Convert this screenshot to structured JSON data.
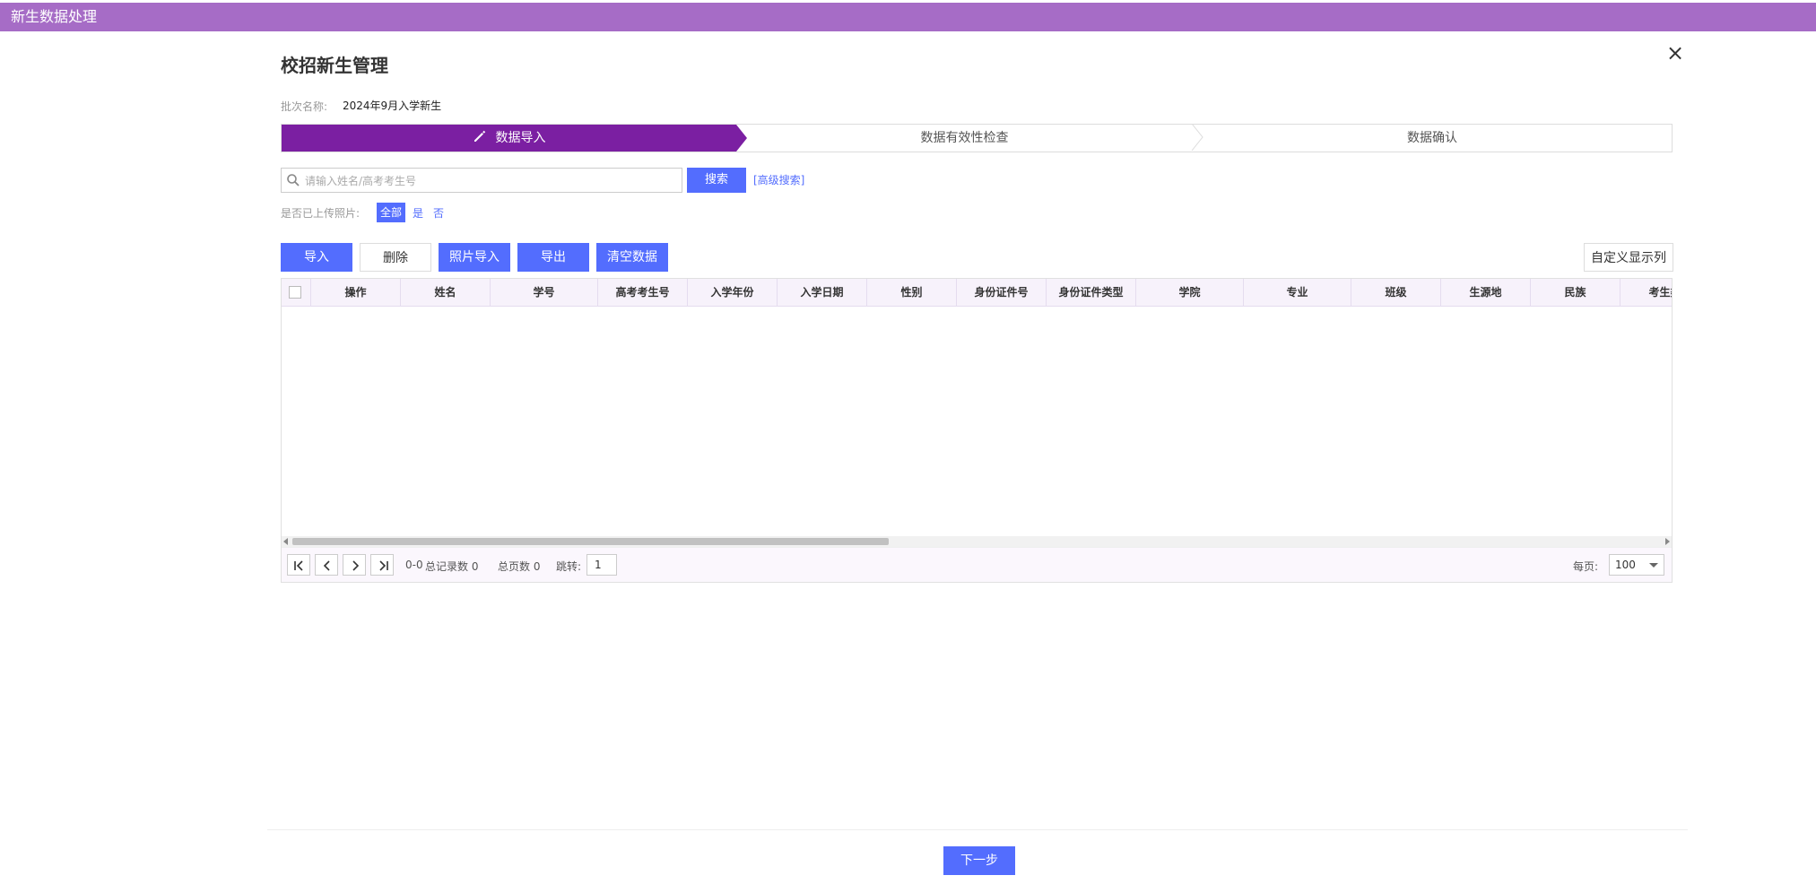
{
  "topbar": {
    "title": "新生数据处理"
  },
  "dialog": {
    "title": "校招新生管理",
    "close_symbol": "×",
    "batch_label": "批次名称:",
    "batch_value": "2024年9月入学新生"
  },
  "steps": [
    {
      "label": "数据导入",
      "active": true,
      "icon": "pencil-icon"
    },
    {
      "label": "数据有效性检查",
      "active": false
    },
    {
      "label": "数据确认",
      "active": false
    }
  ],
  "search": {
    "placeholder": "请输入姓名/高考考生号",
    "value": "",
    "button": "搜索",
    "advanced": "[高级搜索]"
  },
  "photo_filter": {
    "label": "是否已上传照片:",
    "options": [
      "全部",
      "是",
      "否"
    ],
    "selected": "全部"
  },
  "toolbar": {
    "import": "导入",
    "delete": "删除",
    "photo_import": "照片导入",
    "export": "导出",
    "clear": "清空数据",
    "custom_columns": "自定义显示列"
  },
  "table": {
    "columns": [
      "操作",
      "姓名",
      "学号",
      "高考考生号",
      "入学年份",
      "入学日期",
      "性别",
      "身份证件号",
      "身份证件类型",
      "学院",
      "专业",
      "班级",
      "生源地",
      "民族",
      "考生类"
    ],
    "rows": []
  },
  "pager": {
    "range": "0-0",
    "total_records": "总记录数 0",
    "total_pages": "总页数 0",
    "jump_label": "跳转:",
    "jump_value": "1",
    "per_page_label": "每页:",
    "per_page": "100"
  },
  "footer": {
    "next": "下一步"
  },
  "colors": {
    "topbar": "#a66cc6",
    "active_step": "#7b1fa2",
    "primary": "#536dfe"
  }
}
